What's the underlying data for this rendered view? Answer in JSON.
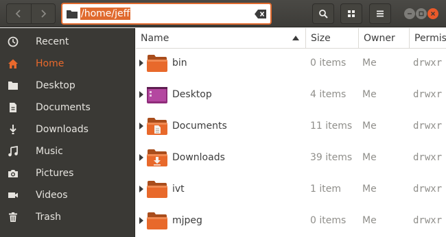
{
  "header": {
    "path": "/home/jeff",
    "back_icon": "chevron-left-icon",
    "forward_icon": "chevron-right-icon",
    "search_icon": "search-icon",
    "view_icon": "grid-view-icon",
    "menu_icon": "hamburger-menu-icon",
    "accent_color": "#e06a2e"
  },
  "sidebar": {
    "items": [
      {
        "label": "Recent",
        "icon": "clock-icon",
        "active": false
      },
      {
        "label": "Home",
        "icon": "home-icon",
        "active": true
      },
      {
        "label": "Desktop",
        "icon": "folder-icon",
        "active": false
      },
      {
        "label": "Documents",
        "icon": "document-icon",
        "active": false
      },
      {
        "label": "Downloads",
        "icon": "download-icon",
        "active": false
      },
      {
        "label": "Music",
        "icon": "music-icon",
        "active": false
      },
      {
        "label": "Pictures",
        "icon": "camera-icon",
        "active": false
      },
      {
        "label": "Videos",
        "icon": "video-icon",
        "active": false
      },
      {
        "label": "Trash",
        "icon": "trash-icon",
        "active": false
      }
    ]
  },
  "columns": {
    "name": "Name",
    "size": "Size",
    "owner": "Owner",
    "permissions": "Permis"
  },
  "files": [
    {
      "name": "bin",
      "size": "0 items",
      "owner": "Me",
      "perm": "drwxr",
      "icon": "folder-icon"
    },
    {
      "name": "Desktop",
      "size": "4 items",
      "owner": "Me",
      "perm": "drwxr",
      "icon": "desktop-folder-icon"
    },
    {
      "name": "Documents",
      "size": "11 items",
      "owner": "Me",
      "perm": "drwxr",
      "icon": "documents-folder-icon"
    },
    {
      "name": "Downloads",
      "size": "39 items",
      "owner": "Me",
      "perm": "drwxr",
      "icon": "downloads-folder-icon"
    },
    {
      "name": "ivt",
      "size": "1 item",
      "owner": "Me",
      "perm": "drwxr",
      "icon": "folder-icon"
    },
    {
      "name": "mjpeg",
      "size": "0 items",
      "owner": "Me",
      "perm": "drwxr",
      "icon": "folder-icon"
    }
  ]
}
